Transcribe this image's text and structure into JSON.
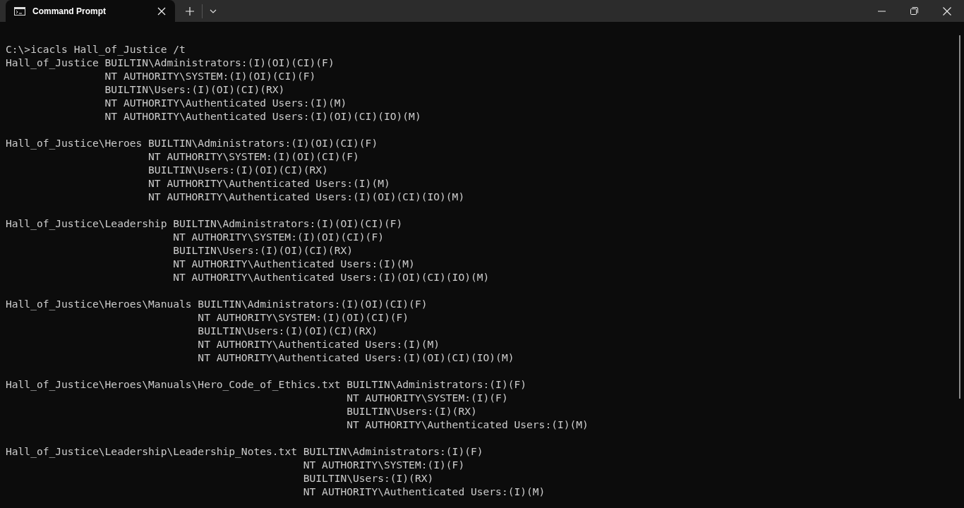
{
  "window": {
    "tab_title": "Command Prompt"
  },
  "terminal": {
    "command_line": "C:\\>icacls Hall_of_Justice /t",
    "blocks": [
      {
        "lines": [
          "Hall_of_Justice BUILTIN\\Administrators:(I)(OI)(CI)(F)",
          "NT AUTHORITY\\SYSTEM:(I)(OI)(CI)(F)",
          "BUILTIN\\Users:(I)(OI)(CI)(RX)",
          "NT AUTHORITY\\Authenticated Users:(I)(M)",
          "NT AUTHORITY\\Authenticated Users:(I)(OI)(CI)(IO)(M)"
        ]
      },
      {
        "lines": [
          "Hall_of_Justice\\Heroes BUILTIN\\Administrators:(I)(OI)(CI)(F)",
          "NT AUTHORITY\\SYSTEM:(I)(OI)(CI)(F)",
          "BUILTIN\\Users:(I)(OI)(CI)(RX)",
          "NT AUTHORITY\\Authenticated Users:(I)(M)",
          "NT AUTHORITY\\Authenticated Users:(I)(OI)(CI)(IO)(M)"
        ]
      },
      {
        "lines": [
          "Hall_of_Justice\\Leadership BUILTIN\\Administrators:(I)(OI)(CI)(F)",
          "NT AUTHORITY\\SYSTEM:(I)(OI)(CI)(F)",
          "BUILTIN\\Users:(I)(OI)(CI)(RX)",
          "NT AUTHORITY\\Authenticated Users:(I)(M)",
          "NT AUTHORITY\\Authenticated Users:(I)(OI)(CI)(IO)(M)"
        ]
      },
      {
        "lines": [
          "Hall_of_Justice\\Heroes\\Manuals BUILTIN\\Administrators:(I)(OI)(CI)(F)",
          "NT AUTHORITY\\SYSTEM:(I)(OI)(CI)(F)",
          "BUILTIN\\Users:(I)(OI)(CI)(RX)",
          "NT AUTHORITY\\Authenticated Users:(I)(M)",
          "NT AUTHORITY\\Authenticated Users:(I)(OI)(CI)(IO)(M)"
        ]
      },
      {
        "lines": [
          "Hall_of_Justice\\Heroes\\Manuals\\Hero_Code_of_Ethics.txt BUILTIN\\Administrators:(I)(F)",
          "NT AUTHORITY\\SYSTEM:(I)(F)",
          "BUILTIN\\Users:(I)(RX)",
          "NT AUTHORITY\\Authenticated Users:(I)(M)"
        ]
      },
      {
        "lines": [
          "Hall_of_Justice\\Leadership\\Leadership_Notes.txt BUILTIN\\Administrators:(I)(F)",
          "NT AUTHORITY\\SYSTEM:(I)(F)",
          "BUILTIN\\Users:(I)(RX)",
          "NT AUTHORITY\\Authenticated Users:(I)(M)"
        ]
      }
    ]
  }
}
